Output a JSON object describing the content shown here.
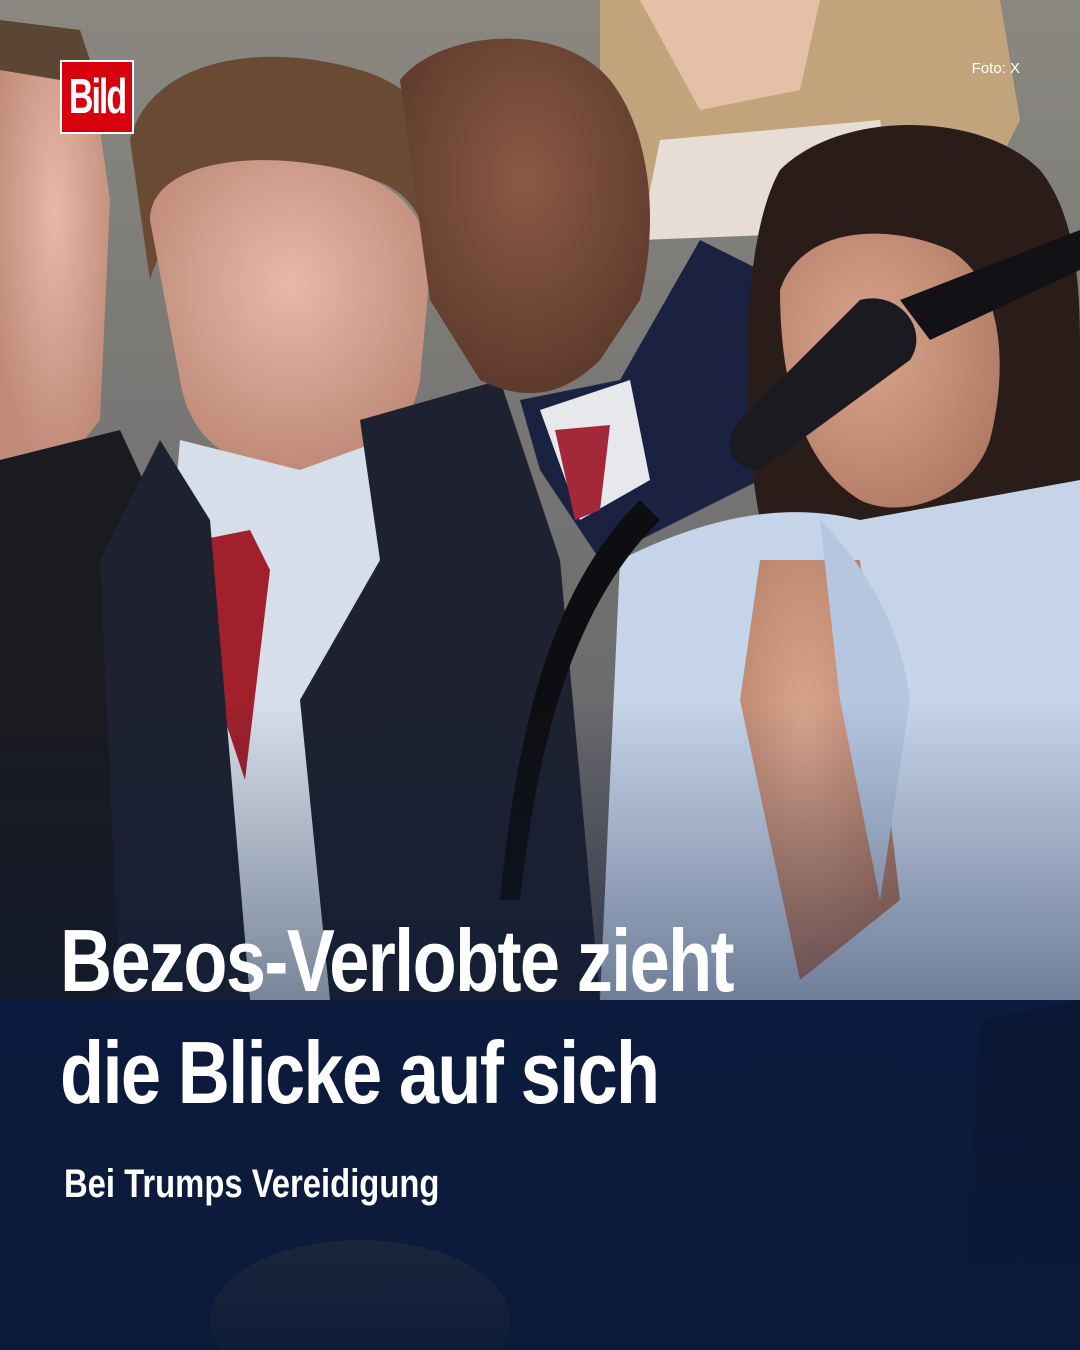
{
  "brand": {
    "logo_text": "Bild",
    "accent_color": "#d9000d"
  },
  "photo_credit": "Foto: X",
  "headline": {
    "line1": "Bezos-Verlobte zieht",
    "line2": "die Blicke auf sich"
  },
  "subheadline": "Bei Trumps Vereidigung",
  "photo": {
    "description_icon": "photo-scene"
  }
}
